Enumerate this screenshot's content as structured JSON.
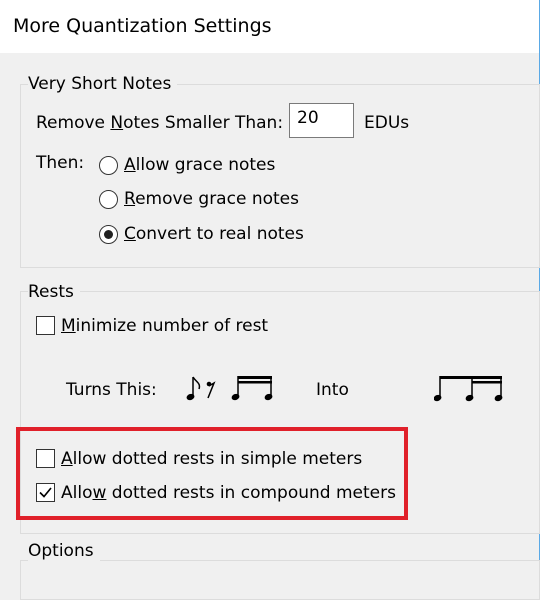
{
  "window": {
    "title": "More Quantization Settings"
  },
  "very_short_notes": {
    "label": "Very Short Notes",
    "remove_label_pre": "Remove ",
    "remove_label_ul": "N",
    "remove_label_post": "otes Smaller Than:",
    "value": "20",
    "units": "EDUs",
    "then_label": "Then:",
    "options": [
      {
        "ul": "A",
        "rest": "llow grace notes",
        "selected": false
      },
      {
        "ul": "R",
        "rest": "emove grace notes",
        "selected": false
      },
      {
        "ul": "C",
        "rest": "onvert to real notes",
        "selected": true
      }
    ]
  },
  "rests": {
    "label": "Rests",
    "minimize": {
      "ul": "M",
      "rest": "inimize number of rests",
      "checked": false
    },
    "turns_this": "Turns This:",
    "into": "Into",
    "dotted_simple": {
      "pre": "",
      "ul": "A",
      "rest": "llow dotted rests in simple meters",
      "checked": false
    },
    "dotted_compound": {
      "pre": "Allo",
      "ul": "w",
      "rest": " dotted rests in compound meters",
      "checked": true
    }
  },
  "options": {
    "label": "Options"
  },
  "colors": {
    "highlight": "#e0202a",
    "window_edge": "#5aa9e6"
  },
  "icons": [
    "radio-button",
    "checkbox",
    "check-icon",
    "music-notation"
  ]
}
